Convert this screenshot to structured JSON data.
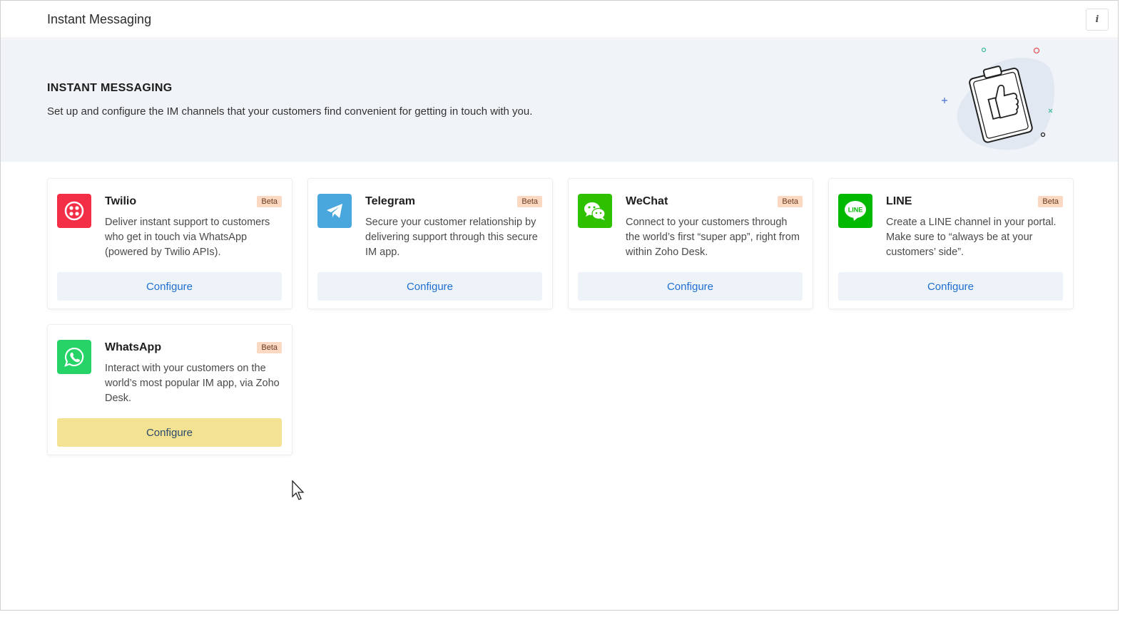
{
  "header": {
    "title": "Instant Messaging",
    "info_icon_label": "i"
  },
  "banner": {
    "heading": "INSTANT MESSAGING",
    "description": "Set up and configure the IM channels that your customers find convenient for getting in touch with you."
  },
  "channels": [
    {
      "name": "Twilio",
      "badge": "Beta",
      "description": "Deliver instant support to customers who get in touch via WhatsApp (powered by Twilio APIs).",
      "button": "Configure",
      "color": "#f22f46"
    },
    {
      "name": "Telegram",
      "badge": "Beta",
      "description": "Secure your customer relationship by delivering support through this secure IM app.",
      "button": "Configure",
      "color": "#4aa7dd"
    },
    {
      "name": "WeChat",
      "badge": "Beta",
      "description": "Connect to your customers through the world’s first “super app”, right from within Zoho Desk.",
      "button": "Configure",
      "color": "#2dc100"
    },
    {
      "name": "LINE",
      "badge": "Beta",
      "description": "Create a LINE channel in your portal. Make sure to “always be at your customers’ side”.",
      "button": "Configure",
      "color": "#00b900",
      "logo_text": "LINE"
    },
    {
      "name": "WhatsApp",
      "badge": "Beta",
      "description": "Interact with your customers on the world’s most popular IM app, via Zoho Desk.",
      "button": "Configure",
      "color": "#25d366"
    }
  ]
}
